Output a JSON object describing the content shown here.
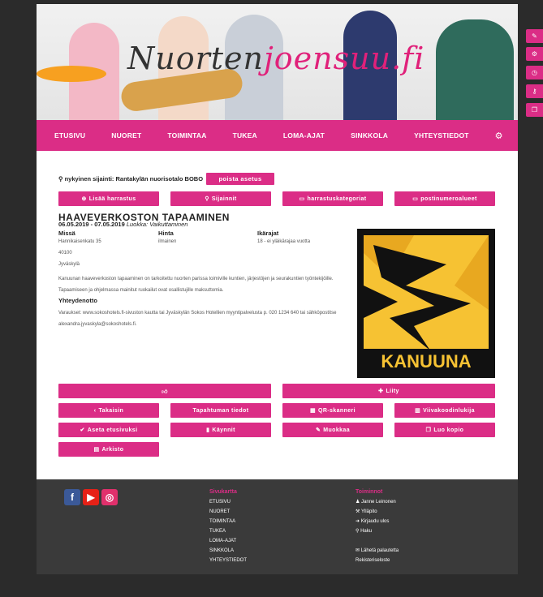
{
  "header": {
    "logo_part1": "Nuorten",
    "logo_part2": "joensuu",
    "logo_part3": ".fi"
  },
  "nav": {
    "items": [
      "ETUSIVU",
      "NUORET",
      "TOIMINTAA",
      "TUKEA",
      "LOMA-AJAT",
      "SINKKOLA",
      "YHTEYSTIEDOT"
    ],
    "settings_icon": "gear-icon"
  },
  "sidetabs": [
    "pencil-icon",
    "gear-icon",
    "clock-icon",
    "key-icon",
    "copy-icon"
  ],
  "location": {
    "label": "nykyinen sijainti: Rantakylän nuorisotalo BOBO",
    "clear_button": "poista asetus"
  },
  "actions_top": [
    "Lisää harrastus",
    "Sijainnit",
    "harrastuskategoriat",
    "postinumeroalueet"
  ],
  "event": {
    "title": "HAAVEVERKOSTON TAPAAMINEN",
    "dates": "06.05.2019 - 07.05.2019",
    "category": "Luokka: Vaikuttaminen",
    "where_label": "Missä",
    "address": "Hannikaisenkatu 35",
    "postcode": "40100",
    "city": "Jyväskylä",
    "price_label": "Hinta",
    "price": "ilmainen",
    "age_label": "Ikärajat",
    "age": "18 - ei yläikärajaa vuotta",
    "description": "Kanuunan haaveverkoston tapaaminen on tarkoitettu nuorten parissa toimiville kuntien, järjestöjen ja seurakuntien työntekijöille. Tapaamiseen ja ohjelmassa mainitut ruokailut ovat osallistujille maksuttomia.",
    "contact_label": "Yhteydenotto",
    "contact": "Varaukset: www.sokoshotels.fi-sivuston kautta tai Jyväskylän Sokos Hotellien myyntipalvelusta p. 020 1234 640 tai sähköpostitse alexandra.jyvaskyla@sokoshotels.fi.",
    "image_text": "KANUUNA"
  },
  "actions": {
    "like": "",
    "join": "Liity",
    "back": "Takaisin",
    "event_details": "Tapahtuman tiedot",
    "qr": "QR-skanneri",
    "barcode": "Viivakoodinlukija",
    "set_front": "Aseta etusivuksi",
    "visits": "Käynnit",
    "edit": "Muokkaa",
    "copy": "Luo kopio",
    "archive": "Arkisto"
  },
  "footer": {
    "sitemap_label": "Sivukartta",
    "sitemap": [
      "ETUSIVU",
      "NUORET",
      "TOIMINTAA",
      "TUKEA",
      "LOMA-AJAT",
      "SINKKOLA",
      "YHTEYSTIEDOT"
    ],
    "functions_label": "Toiminnot",
    "functions": [
      "Janne Leinonen",
      "Ylläpito",
      "Kirjaudu ulos",
      "Haku"
    ],
    "functions2": [
      "Lähetä palautetta",
      "Rekisteriseloste"
    ]
  },
  "colors": {
    "accent": "#db2d86",
    "footer_bg": "#3a3a3a"
  }
}
